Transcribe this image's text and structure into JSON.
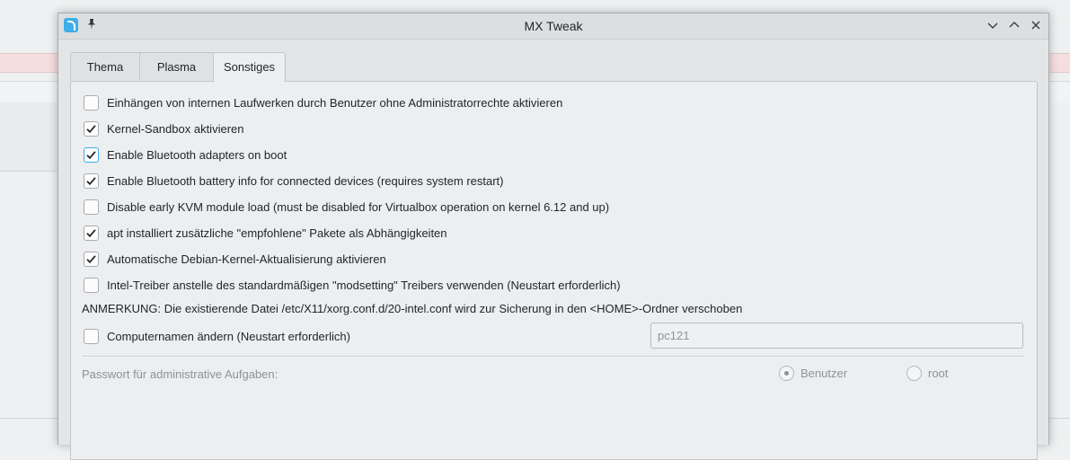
{
  "window": {
    "title": "MX Tweak"
  },
  "tabs": [
    {
      "label": "Thema",
      "active": false
    },
    {
      "label": "Plasma",
      "active": false
    },
    {
      "label": "Sonstiges",
      "active": true
    }
  ],
  "options": [
    {
      "label": "Einhängen von internen Laufwerken durch Benutzer ohne Administratorrechte aktivieren",
      "checked": false
    },
    {
      "label": "Kernel-Sandbox aktivieren",
      "checked": true
    },
    {
      "label": "Enable Bluetooth adapters on boot",
      "checked": true,
      "focused": true
    },
    {
      "label": "Enable Bluetooth battery info for connected devices (requires system restart)",
      "checked": true
    },
    {
      "label": "Disable early KVM module load (must be disabled for Virtualbox operation on kernel 6.12 and up)",
      "checked": false
    },
    {
      "label": "apt installiert zusätzliche \"empfohlene\" Pakete als Abhängigkeiten",
      "checked": true
    },
    {
      "label": "Automatische Debian-Kernel-Aktualisierung aktivieren",
      "checked": true
    },
    {
      "label": "Intel-Treiber anstelle des standardmäßigen \"modsetting\" Treibers verwenden (Neustart erforderlich)",
      "checked": false
    }
  ],
  "note": "ANMERKUNG: Die existierende Datei /etc/X11/xorg.conf.d/20-intel.conf wird zur Sicherung in den <HOME>-Ordner verschoben",
  "hostname": {
    "label": "Computernamen ändern (Neustart erforderlich)",
    "checked": false,
    "value": "pc121"
  },
  "password": {
    "label": "Passwort für administrative Aufgaben:",
    "options": [
      {
        "label": "Benutzer",
        "selected": true
      },
      {
        "label": "root",
        "selected": false
      }
    ]
  },
  "colors": {
    "accent": "#3daee9",
    "window_bg": "#e3e5e7",
    "disabled_text": "#8e9297"
  }
}
